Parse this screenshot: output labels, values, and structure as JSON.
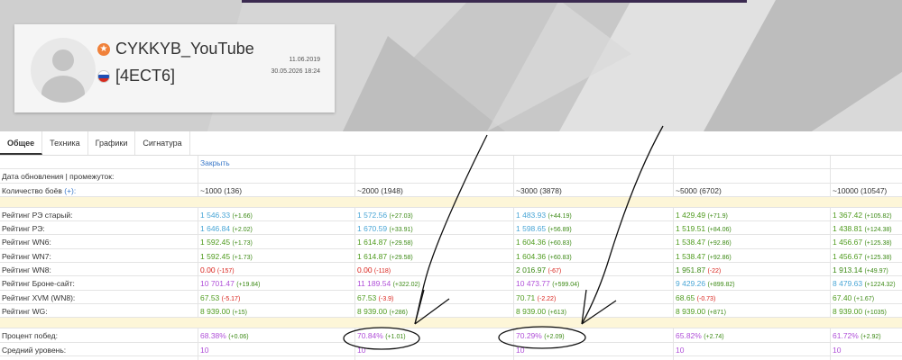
{
  "profile": {
    "nickname": "CYKKYB_YouTube",
    "clan": "[4ECT6]",
    "date_registered": "11.06.2019",
    "date_updated": "30.05.2026 18:24",
    "badge_color": "#f0813a"
  },
  "tabs": [
    "Общее",
    "Техника",
    "Графики",
    "Сигнатура"
  ],
  "close_link": "Закрыть",
  "labels": {
    "update_date": "Дата обновления | промежуток:",
    "battles": "Количество боёв",
    "battles_plus": "(+):"
  },
  "columns": [
    "~1000 (136)",
    "~2000 (1948)",
    "~3000 (3878)",
    "~5000 (6702)",
    "~10000 (10547)"
  ],
  "metrics": [
    {
      "label": "Рейтинг РЭ старый:",
      "color": "blue",
      "cells": [
        [
          "1 546.33",
          "(+1.66)",
          "g"
        ],
        [
          "1 572.56",
          "(+27.03)",
          "g"
        ],
        [
          "1 483.93",
          "(+44.19)",
          "g"
        ],
        [
          "1 429.49",
          "(+71.9)",
          "g"
        ],
        [
          "1 367.42",
          "(+105.82)",
          "g"
        ]
      ],
      "colors": [
        "blue",
        "blue",
        "blue",
        "green",
        "green"
      ]
    },
    {
      "label": "Рейтинг РЭ:",
      "cells": [
        [
          "1 646.84",
          "(+2.02)",
          "g"
        ],
        [
          "1 670.59",
          "(+33.91)",
          "g"
        ],
        [
          "1 598.65",
          "(+56.89)",
          "g"
        ],
        [
          "1 519.51",
          "(+84.06)",
          "g"
        ],
        [
          "1 438.81",
          "(+124.38)",
          "g"
        ]
      ],
      "colors": [
        "blue",
        "blue",
        "blue",
        "green",
        "green"
      ]
    },
    {
      "label": "Рейтинг WN6:",
      "cells": [
        [
          "1 592.45",
          "(+1.73)",
          "g"
        ],
        [
          "1 614.87",
          "(+29.58)",
          "g"
        ],
        [
          "1 604.36",
          "(+60.83)",
          "g"
        ],
        [
          "1 538.47",
          "(+92.86)",
          "g"
        ],
        [
          "1 456.67",
          "(+125.38)",
          "g"
        ]
      ],
      "colors": [
        "green",
        "green",
        "green",
        "green",
        "green"
      ]
    },
    {
      "label": "Рейтинг WN7:",
      "cells": [
        [
          "1 592.45",
          "(+1.73)",
          "g"
        ],
        [
          "1 614.87",
          "(+29.58)",
          "g"
        ],
        [
          "1 604.36",
          "(+60.83)",
          "g"
        ],
        [
          "1 538.47",
          "(+92.86)",
          "g"
        ],
        [
          "1 456.67",
          "(+125.38)",
          "g"
        ]
      ],
      "colors": [
        "green",
        "green",
        "green",
        "green",
        "green"
      ]
    },
    {
      "label": "Рейтинг WN8:",
      "cells": [
        [
          "0.00",
          "(-157)",
          "r"
        ],
        [
          "0.00",
          "(-118)",
          "r"
        ],
        [
          "2 016.97",
          "(-67)",
          "r"
        ],
        [
          "1 951.87",
          "(-22)",
          "r"
        ],
        [
          "1 913.14",
          "(+49.97)",
          "g"
        ]
      ],
      "colors": [
        "red",
        "red",
        "dgreen",
        "dgreen",
        "dgreen"
      ]
    },
    {
      "label": "Рейтинг Броне-сайт:",
      "cells": [
        [
          "10 701.47",
          "(+19.84)",
          "g"
        ],
        [
          "11 189.54",
          "(+322.02)",
          "g"
        ],
        [
          "10 473.77",
          "(+599.04)",
          "g"
        ],
        [
          "9 429.26",
          "(+899.82)",
          "g"
        ],
        [
          "8 479.63",
          "(+1224.32)",
          "g"
        ]
      ],
      "colors": [
        "purple",
        "purple",
        "purple",
        "blue",
        "blue"
      ]
    },
    {
      "label": "Рейтинг XVM (WN8):",
      "cells": [
        [
          "67.53",
          "(-5.17)",
          "r"
        ],
        [
          "67.53",
          "(-3.9)",
          "r"
        ],
        [
          "70.71",
          "(-2.22)",
          "r"
        ],
        [
          "68.65",
          "(-0.73)",
          "r"
        ],
        [
          "67.40",
          "(+1.67)",
          "g"
        ]
      ],
      "colors": [
        "green",
        "green",
        "green",
        "green",
        "green"
      ]
    },
    {
      "label": "Рейтинг WG:",
      "cells": [
        [
          "8 939.00",
          "(+15)",
          "g"
        ],
        [
          "8 939.00",
          "(+286)",
          "g"
        ],
        [
          "8 939.00",
          "(+613)",
          "g"
        ],
        [
          "8 939.00",
          "(+871)",
          "g"
        ],
        [
          "8 939.00",
          "(+1035)",
          "g"
        ]
      ],
      "colors": [
        "green",
        "green",
        "green",
        "green",
        "green"
      ]
    }
  ],
  "winrate": {
    "label": "Процент побед:",
    "cells": [
      [
        "68.38%",
        "(+0.06)",
        "g"
      ],
      [
        "70.84%",
        "(+1.01)",
        "g"
      ],
      [
        "70.29%",
        "(+2.09)",
        "g"
      ],
      [
        "65.82%",
        "(+2.74)",
        "g"
      ],
      [
        "61.72%",
        "(+2.92)",
        "g"
      ]
    ],
    "colors": [
      "purple",
      "purple",
      "purple",
      "purple",
      "purple"
    ]
  },
  "avg_tier": {
    "label": "Средний уровень:",
    "cells": [
      "10",
      "10",
      "10",
      "10",
      "10"
    ]
  }
}
